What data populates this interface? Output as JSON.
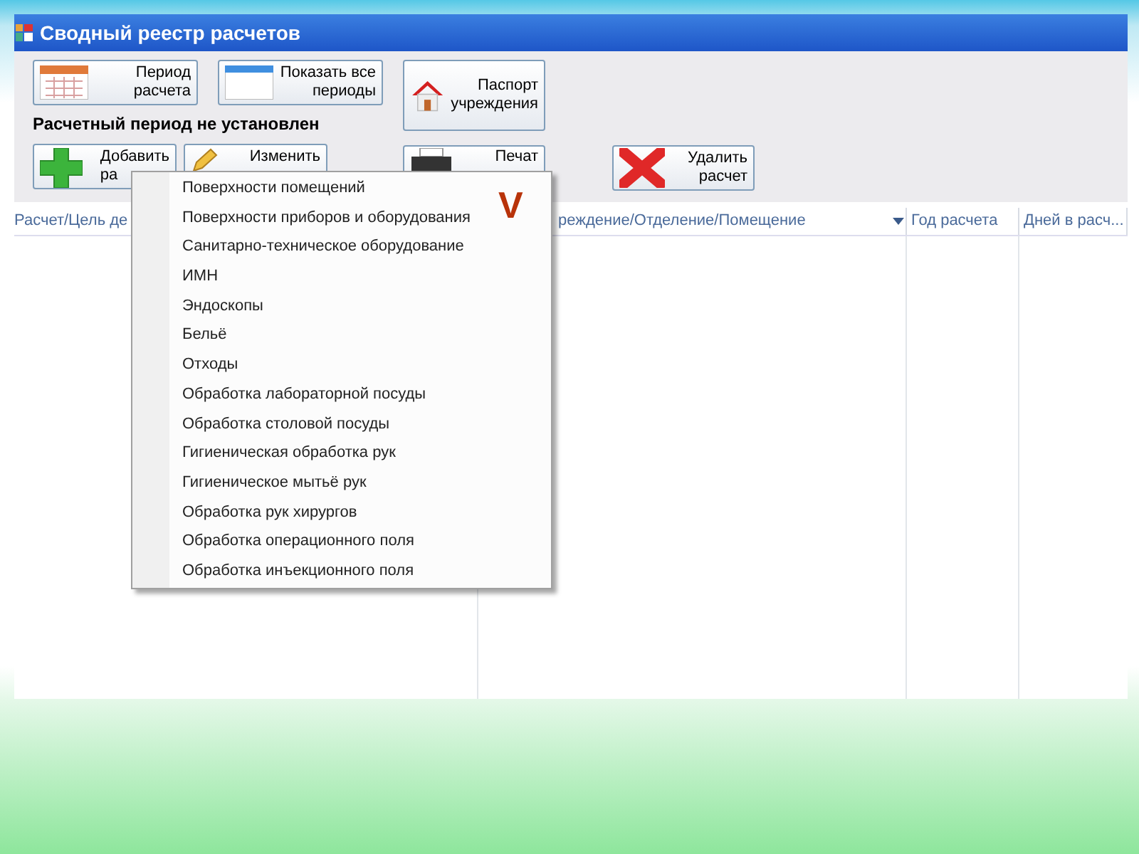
{
  "window": {
    "title": "Сводный реестр расчетов"
  },
  "toolbar_row1": [
    {
      "kind": "calendar",
      "lines": [
        "Период",
        "расчета"
      ]
    },
    {
      "kind": "blank",
      "lines": [
        "Показать все",
        "периоды"
      ]
    }
  ],
  "tall_buttons": [
    {
      "kind": "house",
      "lines": [
        "Паспорт",
        "учреждения"
      ]
    },
    {
      "kind": "printer",
      "lines": [
        "Печат"
      ]
    }
  ],
  "period_status": "Расчетный период не установлен",
  "toolbar_row2": [
    {
      "kind": "plus",
      "lines": [
        "Добавить",
        "ра"
      ]
    },
    {
      "kind": "pencil",
      "lines": [
        "Изменить"
      ]
    }
  ],
  "delete_button": {
    "kind": "cross",
    "lines": [
      "Удалить",
      "расчет"
    ]
  },
  "table": {
    "columns": [
      {
        "label": "Расчет/Цель де",
        "filter": false
      },
      {
        "label": "реждение/Отделение/Помещение",
        "filter": true
      },
      {
        "label": "Год расчета",
        "filter": false
      },
      {
        "label": "Дней в расч...",
        "filter": false
      }
    ]
  },
  "context_menu": {
    "items": [
      "Поверхности помещений",
      "Поверхности приборов и оборудования",
      "Санитарно-техническое оборудование",
      "ИМН",
      "Эндоскопы",
      "Бельё",
      "Отходы",
      "Обработка лабораторной посуды",
      "Обработка столовой посуды",
      "Гигиеническая обработка рук",
      "Гигиеническое мытьё рук",
      "Обработка рук хирургов",
      "Обработка операционного поля",
      "Обработка инъекционного поля"
    ]
  },
  "annotation": "V"
}
